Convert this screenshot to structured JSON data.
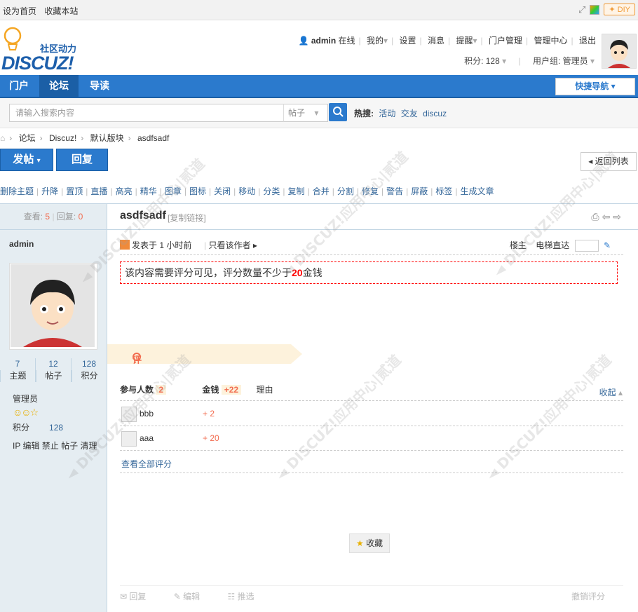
{
  "topbar": {
    "set_home": "设为首页",
    "bookmark": "收藏本站",
    "diy": "DIY"
  },
  "logo": {
    "community": "社区动力",
    "brand": "DISCUZ!"
  },
  "user": {
    "name": "admin",
    "status": "在线",
    "mine": "我的",
    "settings": "设置",
    "messages": "消息",
    "reminders": "提醒",
    "portal_admin": "门户管理",
    "admin_center": "管理中心",
    "logout": "退出",
    "points_label": "积分: 128",
    "group_label": "用户组: 管理员"
  },
  "nav": {
    "portal": "门户",
    "forum": "论坛",
    "guide": "导读",
    "quick_nav": "快捷导航"
  },
  "search": {
    "placeholder": "请输入搜索内容",
    "type": "帖子",
    "hot_label": "热搜:",
    "hot": [
      "活动",
      "交友",
      "discuz"
    ]
  },
  "breadcrumb": [
    "论坛",
    "Discuz!",
    "默认版块",
    "asdfsadf"
  ],
  "actions": {
    "post": "发帖",
    "reply": "回复",
    "back": "返回列表"
  },
  "mod_actions": [
    "删除主题",
    "升降",
    "置顶",
    "直播",
    "高亮",
    "精华",
    "图章",
    "图标",
    "关闭",
    "移动",
    "分类",
    "复制",
    "合并",
    "分割",
    "修复",
    "警告",
    "屏蔽",
    "标签",
    "生成文章"
  ],
  "thread": {
    "views_label": "查看:",
    "views": "5",
    "replies_label": "回复:",
    "replies": "0",
    "title": "asdfsadf",
    "copy_link": "[复制链接]",
    "posted": "发表于 1 小时前",
    "only_author": "只看该作者",
    "floor": "楼主",
    "elevator": "电梯直达",
    "hidden_prefix": "该内容需要评分可见，评分数量不少于",
    "hidden_amount": "20",
    "hidden_suffix": "金钱"
  },
  "author": {
    "name": "admin",
    "stats": [
      {
        "value": "7",
        "label": "主题"
      },
      {
        "value": "12",
        "label": "帖子"
      },
      {
        "value": "128",
        "label": "积分"
      }
    ],
    "group": "管理员",
    "points_label": "积分",
    "points": "128",
    "mod_links": "IP 编辑 禁止 帖子 清理"
  },
  "rating": {
    "title": "评分",
    "participants_label": "参与人数",
    "participants": "2",
    "money_label": "金钱",
    "money_total": "+22",
    "reason_label": "理由",
    "collapse": "收起",
    "rows": [
      {
        "name": "bbb",
        "amount": "+ 2"
      },
      {
        "name": "aaa",
        "amount": "+ 20"
      }
    ],
    "view_all": "查看全部评分"
  },
  "footer": {
    "favorite": "收藏",
    "reply": "回复",
    "edit": "编辑",
    "recommend": "推选",
    "revoke_rating": "撤销评分"
  },
  "colors": {
    "primary": "#2b7acd",
    "accent": "#f26c4f",
    "sidebar": "#e5edf2"
  }
}
